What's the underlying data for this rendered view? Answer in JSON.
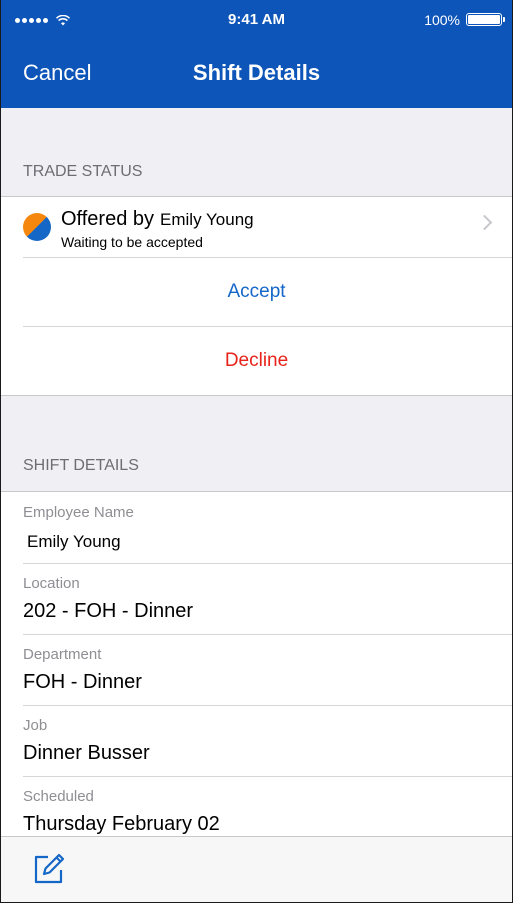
{
  "status_bar": {
    "time": "9:41 AM",
    "battery_percent": "100%",
    "battery_level": 1.0,
    "signal_bars": 5
  },
  "nav": {
    "cancel_label": "Cancel",
    "title": "Shift Details"
  },
  "trade_status": {
    "header": "TRADE STATUS",
    "offered_label": "Offered by",
    "offered_name": "Emily Young",
    "status_text": "Waiting to be accepted",
    "accept_label": "Accept",
    "decline_label": "Decline"
  },
  "shift_details": {
    "header": "SHIFT DETAILS",
    "fields": [
      {
        "label": "Employee Name",
        "value": "Emily Young"
      },
      {
        "label": "Location",
        "value": "202 - FOH - Dinner"
      },
      {
        "label": "Department",
        "value": "FOH - Dinner"
      },
      {
        "label": "Job",
        "value": "Dinner Busser"
      },
      {
        "label": "Scheduled",
        "value": "Thursday February 02"
      }
    ]
  },
  "colors": {
    "brand_blue": "#0d55b8",
    "accent_blue": "#1567c7",
    "accent_orange": "#f5870f",
    "decline_red": "#e8231b"
  },
  "icons": {
    "toolbar_edit": "edit-icon",
    "trade_status": "pie-status-icon",
    "disclosure": "chevron-right-icon"
  }
}
